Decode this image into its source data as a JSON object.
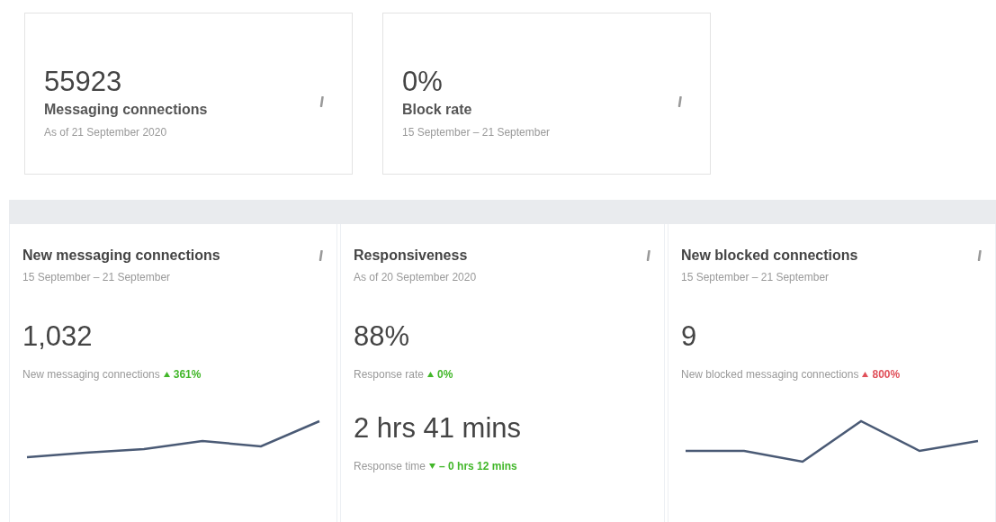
{
  "summary_cards": [
    {
      "value": "55923",
      "title": "Messaging connections",
      "subtitle": "As of 21 September 2020"
    },
    {
      "value": "0%",
      "title": "Block rate",
      "subtitle": "15 September – 21 September"
    }
  ],
  "panels": [
    {
      "title": "New messaging connections",
      "subtitle": "15 September – 21 September",
      "sparkline": true,
      "metrics": [
        {
          "value": "1,032",
          "label": "New messaging connections",
          "change": {
            "kind": "increase",
            "text": "361%",
            "color": "#42b72a"
          }
        }
      ]
    },
    {
      "title": "Responsiveness",
      "subtitle": "As of 20 September 2020",
      "metrics": [
        {
          "value": "88%",
          "label": "Response rate",
          "change": {
            "kind": "increase",
            "text": "0%",
            "color": "#42b72a"
          }
        },
        {
          "value": "2 hrs 41 mins",
          "label": "Response time",
          "change": {
            "kind": "decrease",
            "text": "– 0 hrs 12 mins",
            "color": "#42b72a"
          }
        }
      ]
    },
    {
      "title": "New blocked connections",
      "subtitle": "15 September – 21 September",
      "sparkline": true,
      "metrics": [
        {
          "value": "9",
          "label": "New blocked messaging connections",
          "change": {
            "kind": "increase",
            "text": "800%",
            "color": "#e0505a"
          }
        }
      ]
    }
  ]
}
